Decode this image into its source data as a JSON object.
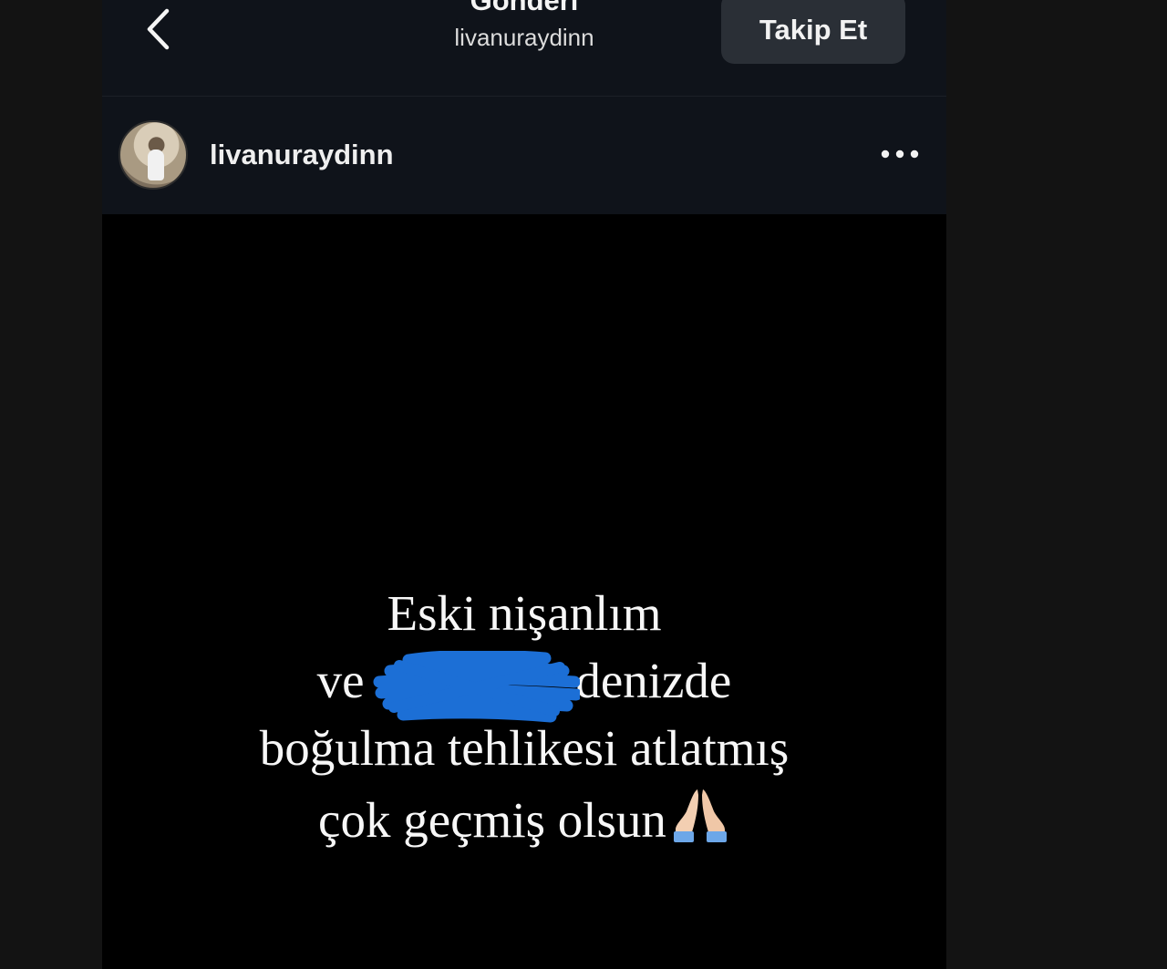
{
  "header": {
    "title": "Gönderi",
    "subtitle": "livanuraydinn",
    "follow_label": "Takip Et"
  },
  "post": {
    "username": "livanuraydinn",
    "lines": [
      "Eski nişanlım",
      "ve ",
      "denizde",
      "boğulma tehlikesi atlatmış",
      "çok geçmiş olsun"
    ]
  },
  "icons": {
    "back": "chevron-left-icon",
    "more": "more-horizontal-icon",
    "emoji": "folded-hands-icon"
  },
  "colors": {
    "background": "#000000",
    "bar": "#0f131a",
    "button": "#2a2f36",
    "scribble": "#1c6fd6"
  }
}
